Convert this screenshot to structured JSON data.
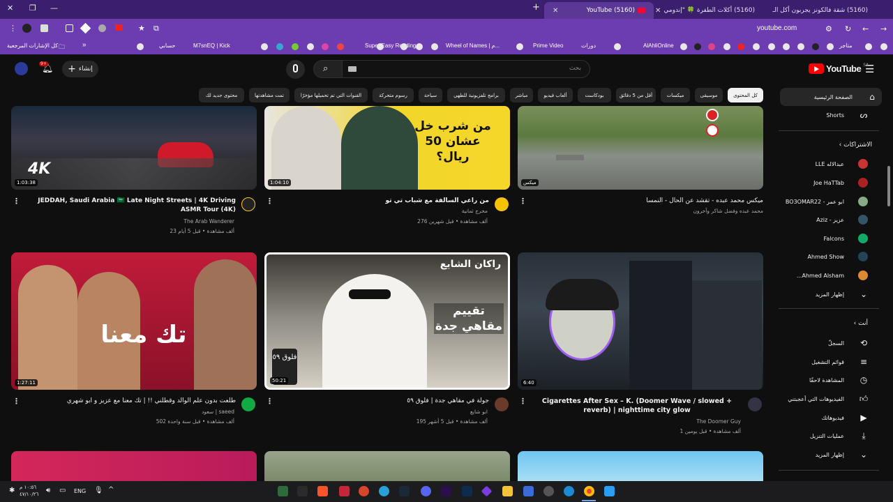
{
  "browser": {
    "tabs": [
      {
        "title": "(5160) YouTube",
        "active": true
      },
      {
        "title": "(5160) أكلات الطفرة 🍀 \"إندومي",
        "active": false
      },
      {
        "title": "(5160) شقة فالكونز يجربون أكل الـ",
        "active": false
      }
    ],
    "new_tab_label": "+",
    "url": "youtube.com",
    "bookmarks": {
      "all_bookmarks": "كل الإشارات المرجعية",
      "items": [
        "حسابي",
        "M7snEQ | Kick",
        "Super Easy Reading",
        "Wheel of Names | م...",
        "Prime Video",
        "دورات",
        "AlAhliOnline",
        "متاجر"
      ]
    }
  },
  "youtube": {
    "logo_text": "YouTube",
    "region": "SA",
    "search_placeholder": "بحث",
    "search_value": "",
    "create_label": "إنشاء",
    "notif_count": "9+",
    "chips": [
      "كل المحتوى",
      "موسيقى",
      "ميكسات",
      "أقل من 5 دقائق",
      "بودكاست",
      "ألعاب فيديو",
      "مباشر",
      "برامج تلفزيونية للطهي",
      "سياحة",
      "رسوم متحركة",
      "القنوات التي تم تحميلها مؤخرًا",
      "تمت مشاهدتها",
      "محتوى جديد لك"
    ]
  },
  "sidebar": {
    "home": "الصفحة الرئيسية",
    "shorts": "Shorts",
    "subs_header": "الاشتراكات",
    "subs": [
      {
        "name": "عبدالاله LLE",
        "color": "#c33"
      },
      {
        "name": "Joe HaTTab",
        "color": "#a22"
      },
      {
        "name": "ابو عمر - BO3OMAR22",
        "color": "#8a8"
      },
      {
        "name": "عزيز - Aziz",
        "color": "#356"
      },
      {
        "name": "Falcons",
        "color": "#1a6"
      },
      {
        "name": "Ahmed Show",
        "color": "#245"
      },
      {
        "name": "Ahmed Alsham...",
        "color": "#d83"
      }
    ],
    "show_more": "إظهار المزيد",
    "you_header": "أنت",
    "you_items": [
      "السجلّ",
      "قوائم التشغيل",
      "المشاهدة لاحقًا",
      "الفيديوهات التي أعجبتني",
      "فيديوهاتك",
      "عمليات التنزيل",
      "إظهار المزيد"
    ]
  },
  "videos": [
    {
      "title": "JEDDAH, Saudi Arabia 🇸🇦 Late Night Streets | 4K Driving ASMR Tour (4K)",
      "channel": "The Arab Wanderer",
      "meta": "23 ألف مشاهدة • قبل 5 أيام",
      "duration": "1:03:38",
      "thumb_text": "4K"
    },
    {
      "title": "من راعي السالفة مع شباب تي تو",
      "channel": "مخرج ثمانية",
      "meta": "276 ألف مشاهدة • قبل شهرين",
      "duration": "1:04:10",
      "thumb_text": "من شرب خل عشان 50 ريال؟"
    },
    {
      "title": "ميكس محمد عبده - تقشد عن الحال - النمسا",
      "channel": "محمد عبده وفضل شاكر وآخرون",
      "meta": "",
      "duration": "ميكس",
      "thumb_text": ""
    },
    {
      "title": "طلعت بدون علم الوالد وقطلني !! | تك معنا مع عزيز و ابو شهري",
      "channel": "سعود | saeed",
      "meta": "502 ألف مشاهدة • قبل سنة واحدة",
      "duration": "1:27:11",
      "thumb_text": "تك معنا"
    },
    {
      "title": "جولة في مقاهي جدة | فلوق ٥٩",
      "channel": "ابو شايع",
      "meta": "195 ألف مشاهدة • قبل 5 أشهر",
      "duration": "50:21",
      "thumb_text": "راكان الشايع",
      "thumb_text2": "تقييم مقاهي جدة",
      "thumb_badge": "فلوق ٥٩"
    },
    {
      "title": "Cigarettes After Sex – K. (Doomer Wave / slowed + reverb) | nighttime city glow",
      "channel": "The Doomer Guy",
      "meta": "1 ألف مشاهدة • قبل يومين",
      "duration": "6:40",
      "thumb_text": ""
    }
  ],
  "taskbar": {
    "time": "١٠:٥٦ م",
    "date": "٤٧/١٠/٢٦",
    "lang": "ENG"
  }
}
